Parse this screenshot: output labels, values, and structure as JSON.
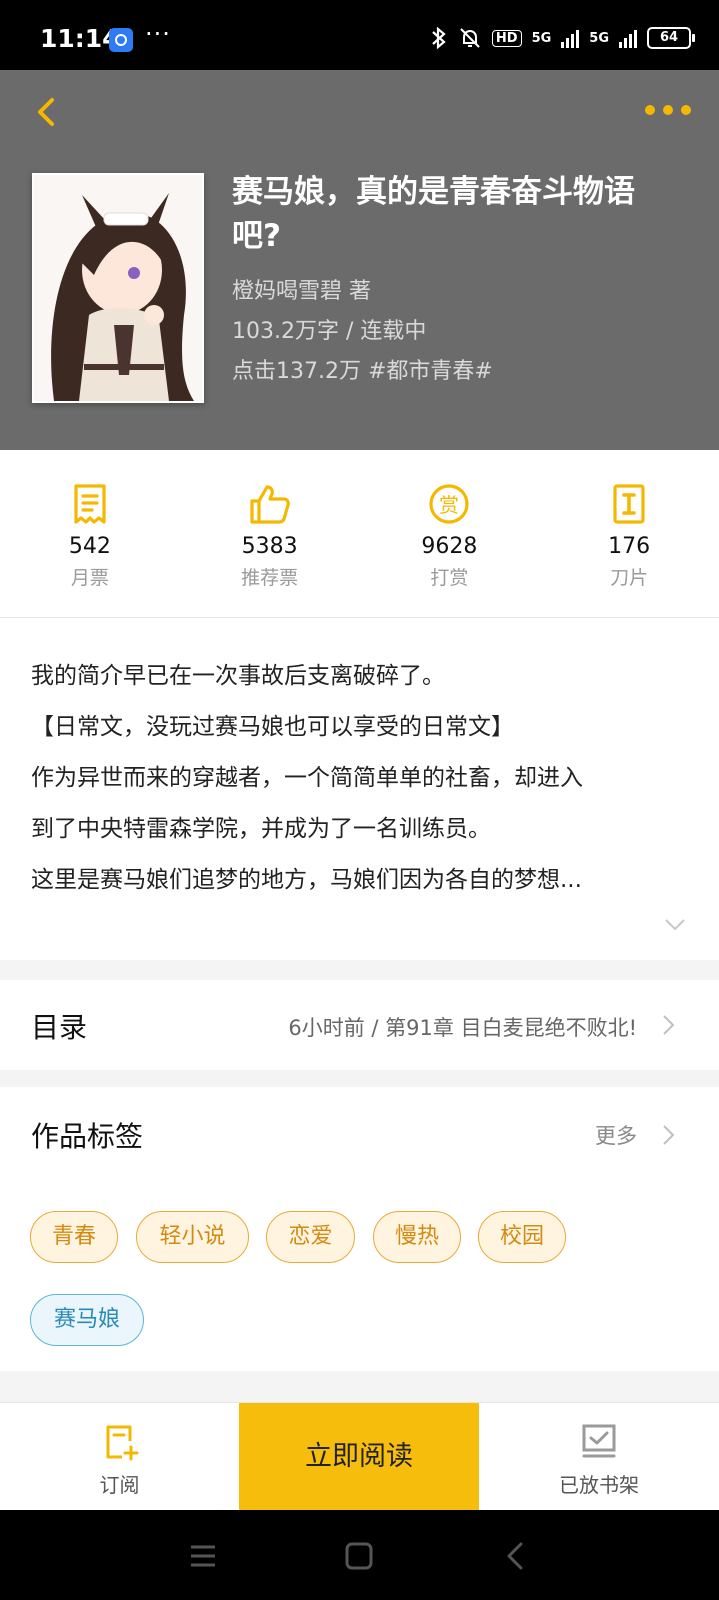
{
  "status_bar": {
    "time": "11:14",
    "more": "···",
    "hd": "HD",
    "net1": "5G",
    "net2": "5G",
    "battery": "64"
  },
  "book": {
    "title": "赛马娘，真的是青春奋斗物语吧?",
    "author_line": "橙妈喝雪碧  著",
    "words_line": "103.2万字 / 连载中",
    "clicks_line": "点击137.2万  #都市青春#"
  },
  "stats": [
    {
      "value": "542",
      "label": "月票",
      "icon": "ticket-icon"
    },
    {
      "value": "5383",
      "label": "推荐票",
      "icon": "thumbs-up-icon"
    },
    {
      "value": "9628",
      "label": "打赏",
      "icon": "reward-coin-icon"
    },
    {
      "value": "176",
      "label": "刀片",
      "icon": "blade-icon"
    }
  ],
  "synopsis": [
    "我的简介早已在一次事故后支离破碎了。",
    "【日常文，没玩过赛马娘也可以享受的日常文】",
    "作为异世而来的穿越者，一个简简单单的社畜，却进入",
    "到了中央特雷森学院，并成为了一名训练员。",
    "这里是赛马娘们追梦的地方，马娘们因为各自的梦想..."
  ],
  "toc": {
    "title": "目录",
    "latest": "6小时前 / 第91章 目白麦昆绝不败北!"
  },
  "tags": {
    "title": "作品标签",
    "more": "更多",
    "items": [
      "青春",
      "轻小说",
      "恋爱",
      "慢热",
      "校园",
      "赛马娘"
    ]
  },
  "bottom_bar": {
    "subscribe": "订阅",
    "read_now": "立即阅读",
    "shelf": "已放书架"
  },
  "colors": {
    "accent": "#f7bd0c",
    "header_bg": "#6b6b6b",
    "tag_orange": "#e9a93a",
    "tag_blue": "#62b3d6"
  }
}
